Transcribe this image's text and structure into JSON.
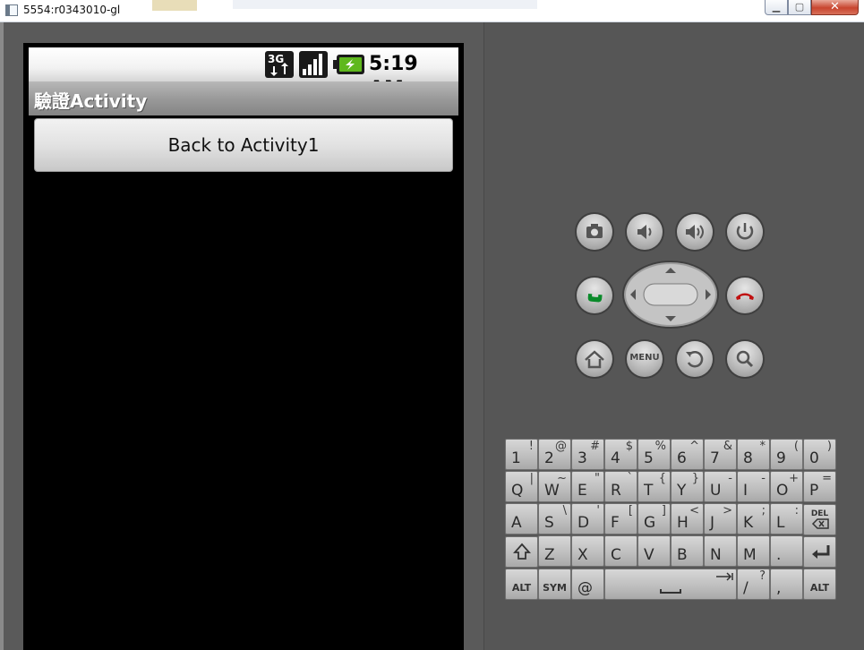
{
  "window": {
    "title": "5554:r0343010-gl"
  },
  "status_bar": {
    "network_icon": "3g-data-icon",
    "signal_icon": "signal-strength-icon",
    "battery_icon": "battery-charging-icon",
    "time": "5:19 AM"
  },
  "app": {
    "title": "驗證Activity",
    "back_button_label": "Back to Activity1"
  },
  "controls": {
    "menu_label": "MENU"
  },
  "keyboard": {
    "rows": [
      [
        [
          "1",
          "!"
        ],
        [
          "2",
          "@"
        ],
        [
          "3",
          "#"
        ],
        [
          "4",
          "$"
        ],
        [
          "5",
          "%"
        ],
        [
          "6",
          "^"
        ],
        [
          "7",
          "&"
        ],
        [
          "8",
          "*"
        ],
        [
          "9",
          "("
        ],
        [
          "0",
          ")"
        ]
      ],
      [
        [
          "Q",
          "|"
        ],
        [
          "W",
          "~"
        ],
        [
          "E",
          "\""
        ],
        [
          "R",
          "`"
        ],
        [
          "T",
          "{"
        ],
        [
          "Y",
          "}"
        ],
        [
          "U",
          "-"
        ],
        [
          "I",
          "-"
        ],
        [
          "O",
          "+"
        ],
        [
          "P",
          "="
        ]
      ],
      [
        [
          "A",
          ""
        ],
        [
          "S",
          "\\"
        ],
        [
          "D",
          "'"
        ],
        [
          "F",
          "["
        ],
        [
          "G",
          "]"
        ],
        [
          "H",
          "<"
        ],
        [
          "J",
          ">"
        ],
        [
          "K",
          ";"
        ],
        [
          "L",
          ":"
        ]
      ],
      [
        [
          "Z",
          ""
        ],
        [
          "X",
          ""
        ],
        [
          "C",
          ""
        ],
        [
          "V",
          ""
        ],
        [
          "B",
          ""
        ],
        [
          "N",
          ""
        ],
        [
          "M",
          ""
        ],
        [
          ".",
          ""
        ]
      ]
    ],
    "del_label": "DEL",
    "alt_label": "ALT",
    "sym_label": "SYM",
    "at_label": "@",
    "slash_label": "/",
    "question_label": "?",
    "comma_label": ","
  },
  "colors": {
    "emulator_skin": "#565656",
    "screen_bg": "#000000",
    "call_green": "#0a8a2a",
    "end_red": "#c01010"
  }
}
